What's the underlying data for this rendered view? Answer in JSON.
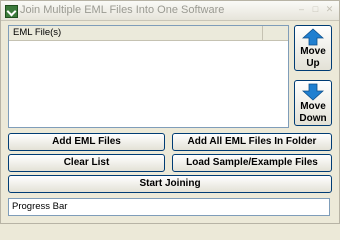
{
  "window": {
    "title": "Join Multiple EML Files Into One Software",
    "controls": {
      "minimize": "–",
      "maximize": "□",
      "close": "✕"
    }
  },
  "file_list": {
    "column_header": "EML File(s)"
  },
  "side_buttons": {
    "move_up": {
      "line1": "Move",
      "line2": "Up",
      "icon": "arrow-up-icon"
    },
    "move_down": {
      "line1": "Move",
      "line2": "Down",
      "icon": "arrow-down-icon"
    }
  },
  "buttons": {
    "add_eml": "Add EML Files",
    "add_folder": "Add All EML Files In Folder",
    "clear_list": "Clear List",
    "load_sample": "Load Sample/Example Files",
    "start": "Start Joining"
  },
  "progress": {
    "label": "Progress Bar"
  },
  "colors": {
    "arrow": "#1f7fd0",
    "border": "#003c74",
    "background": "#ece9d8"
  }
}
